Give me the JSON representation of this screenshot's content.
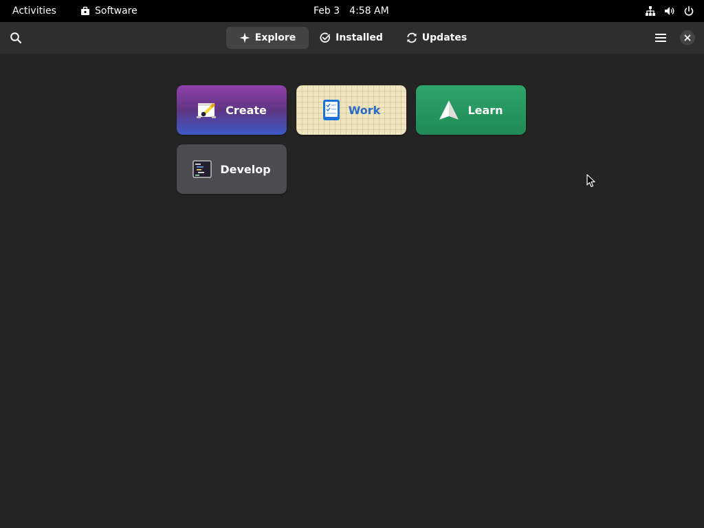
{
  "topbar": {
    "activities": "Activities",
    "app_name": "Software",
    "date": "Feb 3",
    "time": "4:58 AM",
    "icons": [
      "network-icon",
      "volume-icon",
      "power-icon"
    ]
  },
  "header": {
    "tabs": [
      {
        "label": "Explore",
        "icon": "explore-icon",
        "active": true
      },
      {
        "label": "Installed",
        "icon": "check-circle-icon",
        "active": false
      },
      {
        "label": "Updates",
        "icon": "refresh-icon",
        "active": false
      }
    ],
    "left_icon": "search-icon",
    "right_icons": [
      "hamburger-menu-icon",
      "close-icon"
    ]
  },
  "categories": [
    {
      "label": "Create",
      "icon": "create-palette-icon",
      "accent": "#9141ac"
    },
    {
      "label": "Work",
      "icon": "work-checklist-icon",
      "accent": "#2a6bc9"
    },
    {
      "label": "Learn",
      "icon": "paper-plane-icon",
      "accent": "#26a269"
    },
    {
      "label": "Develop",
      "icon": "terminal-code-icon",
      "accent": "#4b4b50"
    }
  ],
  "colors": {
    "window_bg": "#242424",
    "header_bg": "#2e2e2e",
    "topbar_bg": "#000000"
  }
}
